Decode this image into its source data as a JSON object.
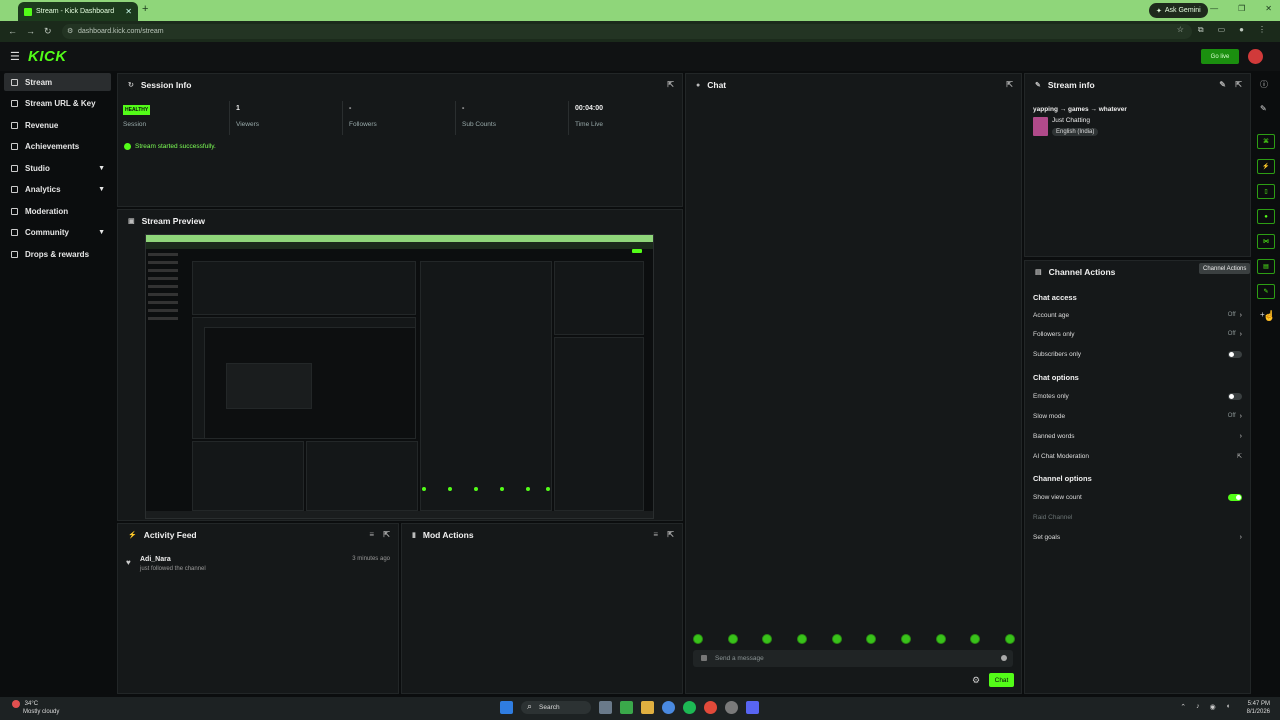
{
  "browser": {
    "tab_title": "Stream - Kick Dashboard",
    "new_tab": "+",
    "ask_gemini": "Ask Gemini",
    "url": "dashboard.kick.com/stream"
  },
  "topnav": {
    "logo": "KICK",
    "go_live": "Go live"
  },
  "sidebar": {
    "items": [
      {
        "label": "Stream"
      },
      {
        "label": "Stream URL & Key"
      },
      {
        "label": "Revenue"
      },
      {
        "label": "Achievements"
      },
      {
        "label": "Studio"
      },
      {
        "label": "Analytics"
      },
      {
        "label": "Moderation"
      },
      {
        "label": "Community"
      },
      {
        "label": "Drops & rewards"
      }
    ]
  },
  "session_info": {
    "title": "Session Info",
    "health": "HEALTHY",
    "session_label": "Session",
    "stats": [
      {
        "value": "1",
        "label": "Viewers"
      },
      {
        "value": "-",
        "label": "Followers"
      },
      {
        "value": "-",
        "label": "Sub Counts"
      },
      {
        "value": "00:04:00",
        "label": "Time Live"
      }
    ],
    "message": "Stream started successfully."
  },
  "stream_preview": {
    "title": "Stream Preview"
  },
  "activity_feed": {
    "title": "Activity Feed",
    "items": [
      {
        "name": "Adi_Nara",
        "action": "just followed the channel",
        "ago": "3 minutes ago"
      }
    ]
  },
  "mod_actions": {
    "title": "Mod Actions"
  },
  "chat": {
    "title": "Chat",
    "placeholder": "Send a message",
    "send_label": "Chat"
  },
  "stream_info": {
    "title": "Stream info",
    "stream_title": "yapping → games → whatever",
    "category": "Just Chatting",
    "language": "English (India)"
  },
  "channel_actions": {
    "title": "Channel Actions",
    "tooltip": "Channel Actions",
    "chat_access": "Chat access",
    "account_age": "Account age",
    "account_age_val": "Off",
    "followers_only": "Followers only",
    "followers_only_val": "Off",
    "subscribers_only": "Subscribers only",
    "chat_options": "Chat options",
    "emotes_only": "Emotes only",
    "slow_mode": "Slow mode",
    "slow_mode_val": "Off",
    "banned_words": "Banned words",
    "ai_moderation": "AI Chat Moderation",
    "channel_options": "Channel options",
    "show_view_count": "Show view count",
    "raid_channel": "Raid Channel",
    "set_goals": "Set goals"
  },
  "taskbar": {
    "temp": "34°C",
    "weather": "Mostly cloudy",
    "search": "Search",
    "time": "5:47 PM",
    "date": "8/1/2026"
  },
  "colors": {
    "accent": "#53fc18",
    "background": "#0b0d0e",
    "panel": "#151819",
    "browser_frame": "#8fd67a"
  }
}
